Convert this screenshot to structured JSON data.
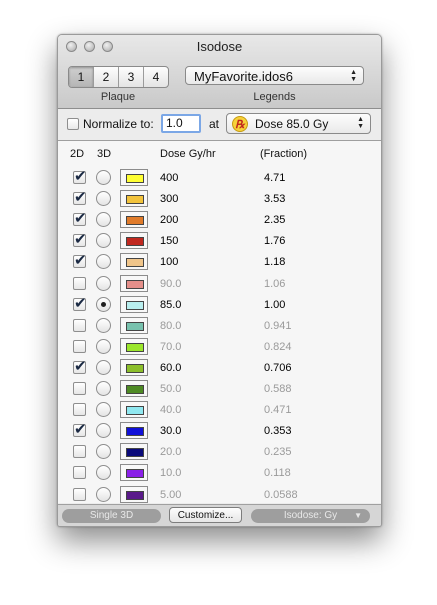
{
  "window": {
    "title": "Isodose"
  },
  "plaque": {
    "tabs": [
      "1",
      "2",
      "3",
      "4"
    ],
    "selected": 0,
    "label": "Plaque"
  },
  "legends": {
    "value": "MyFavorite.idos6",
    "label": "Legends"
  },
  "normalize": {
    "label": "Normalize to:",
    "value": "1.0",
    "at_label": "at",
    "reference": "Dose 85.0 Gy",
    "rx_symbol": "Rx",
    "checked": false
  },
  "table": {
    "headers": {
      "col2d": "2D",
      "col3d": "3D",
      "dose": "Dose Gy/hr",
      "fraction": "(Fraction)"
    },
    "rows": [
      {
        "dose": "400",
        "fraction": "4.71",
        "show2d": true,
        "sel3d": false,
        "color": "#ffff33",
        "active": true
      },
      {
        "dose": "300",
        "fraction": "3.53",
        "show2d": true,
        "sel3d": false,
        "color": "#f2c33c",
        "active": true
      },
      {
        "dose": "200",
        "fraction": "2.35",
        "show2d": true,
        "sel3d": false,
        "color": "#e07b2a",
        "active": true
      },
      {
        "dose": "150",
        "fraction": "1.76",
        "show2d": true,
        "sel3d": false,
        "color": "#c0281f",
        "active": true
      },
      {
        "dose": "100",
        "fraction": "1.18",
        "show2d": true,
        "sel3d": false,
        "color": "#f0c58a",
        "active": true
      },
      {
        "dose": "90.0",
        "fraction": "1.06",
        "show2d": false,
        "sel3d": false,
        "color": "#e58f8a",
        "active": false
      },
      {
        "dose": "85.0",
        "fraction": "1.00",
        "show2d": true,
        "sel3d": true,
        "color": "#b8eeee",
        "active": true
      },
      {
        "dose": "80.0",
        "fraction": "0.941",
        "show2d": false,
        "sel3d": false,
        "color": "#78c2ae",
        "active": false
      },
      {
        "dose": "70.0",
        "fraction": "0.824",
        "show2d": false,
        "sel3d": false,
        "color": "#9be62b",
        "active": false
      },
      {
        "dose": "60.0",
        "fraction": "0.706",
        "show2d": true,
        "sel3d": false,
        "color": "#8cbf2b",
        "active": true
      },
      {
        "dose": "50.0",
        "fraction": "0.588",
        "show2d": false,
        "sel3d": false,
        "color": "#4e8a24",
        "active": false
      },
      {
        "dose": "40.0",
        "fraction": "0.471",
        "show2d": false,
        "sel3d": false,
        "color": "#90e8f0",
        "active": false
      },
      {
        "dose": "30.0",
        "fraction": "0.353",
        "show2d": true,
        "sel3d": false,
        "color": "#1010d8",
        "active": true
      },
      {
        "dose": "20.0",
        "fraction": "0.235",
        "show2d": false,
        "sel3d": false,
        "color": "#0a0a7a",
        "active": false
      },
      {
        "dose": "10.0",
        "fraction": "0.118",
        "show2d": false,
        "sel3d": false,
        "color": "#8a20e8",
        "active": false
      },
      {
        "dose": "5.00",
        "fraction": "0.0588",
        "show2d": false,
        "sel3d": false,
        "color": "#5a1a8a",
        "active": false
      }
    ]
  },
  "footer": {
    "single3d": "Single 3D",
    "customize": "Customize...",
    "isodose_units": "Isodose: Gy",
    "arrow": "▼"
  }
}
